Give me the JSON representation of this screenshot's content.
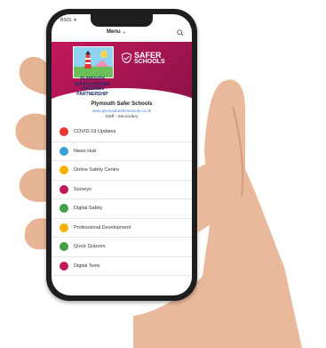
{
  "statusbar": {
    "carrier": "BSOL ✦",
    "time": ""
  },
  "topbar": {
    "menu_label": "Menu"
  },
  "hero": {
    "logo_text": [
      "PLYMOUTH",
      "SAFEGUARDING",
      "CHILDREN",
      "PARTNERSHIP"
    ],
    "brand_line1": "SAFER",
    "brand_line2": "SCHOOLS"
  },
  "org": {
    "title": "Plymouth Safer Schools",
    "link": "www.plymouthsaferschools.co.uk",
    "subtitle": "Staff - Secondary"
  },
  "menu": [
    {
      "label": "COVID-19 Updates",
      "color": "#e53935",
      "icon": "virus-icon"
    },
    {
      "label": "News Hub",
      "color": "#3aa0d8",
      "icon": "news-icon"
    },
    {
      "label": "Online Safety Centre",
      "color": "#f6b400",
      "icon": "shield-icon"
    },
    {
      "label": "Surveys",
      "color": "#c2185b",
      "icon": "survey-icon"
    },
    {
      "label": "Digital Safety",
      "color": "#43a047",
      "icon": "digital-safety-icon"
    },
    {
      "label": "Professional Development",
      "color": "#f6b400",
      "icon": "graduation-icon"
    },
    {
      "label": "Quick Quizzes",
      "color": "#43a047",
      "icon": "quiz-icon"
    },
    {
      "label": "Digital Tests",
      "color": "#c2185b",
      "icon": "test-icon"
    }
  ]
}
